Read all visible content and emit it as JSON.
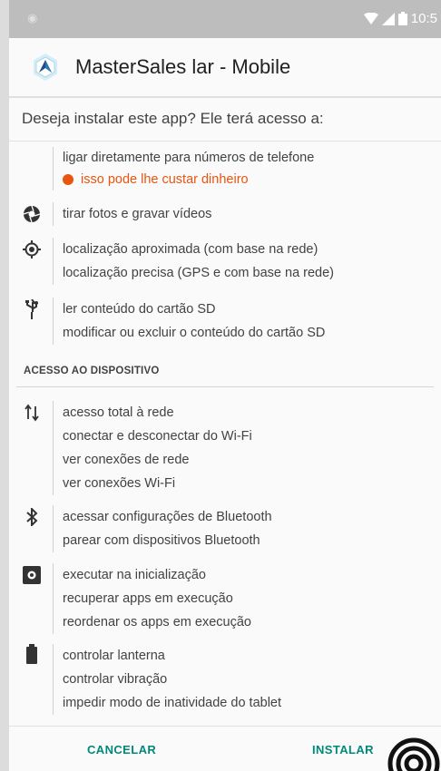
{
  "statusbar": {
    "time": "10:5"
  },
  "header": {
    "app_name": "MasterSales lar - Mobile"
  },
  "question": "Deseja instalar este app? Ele terá acesso a:",
  "phone": {
    "line": "ligar diretamente para números de telefone",
    "cost": "isso pode lhe custar dinheiro"
  },
  "camera": {
    "line1": "tirar fotos e gravar vídeos"
  },
  "location": {
    "line1": "localização aproximada (com base na rede)",
    "line2": "localização precisa (GPS e com base na rede)"
  },
  "storage": {
    "line1": "ler conteúdo do cartão SD",
    "line2": "modificar ou excluir o conteúdo do cartão SD"
  },
  "section": {
    "title": "ACESSO AO DISPOSITIVO"
  },
  "network": {
    "line1": "acesso total à rede",
    "line2": "conectar e desconectar do Wi-Fi",
    "line3": "ver conexões de rede",
    "line4": "ver conexões Wi-Fi"
  },
  "bluetooth": {
    "line1": "acessar configurações de Bluetooth",
    "line2": "parear com dispositivos Bluetooth"
  },
  "system": {
    "line1": "executar na inicialização",
    "line2": "recuperar apps em execução",
    "line3": "reordenar os apps em execução"
  },
  "hardware": {
    "line1": "controlar lanterna",
    "line2": "controlar vibração",
    "line3": "impedir modo de inatividade do tablet"
  },
  "buttons": {
    "cancel": "CANCELAR",
    "install": "INSTALAR"
  }
}
